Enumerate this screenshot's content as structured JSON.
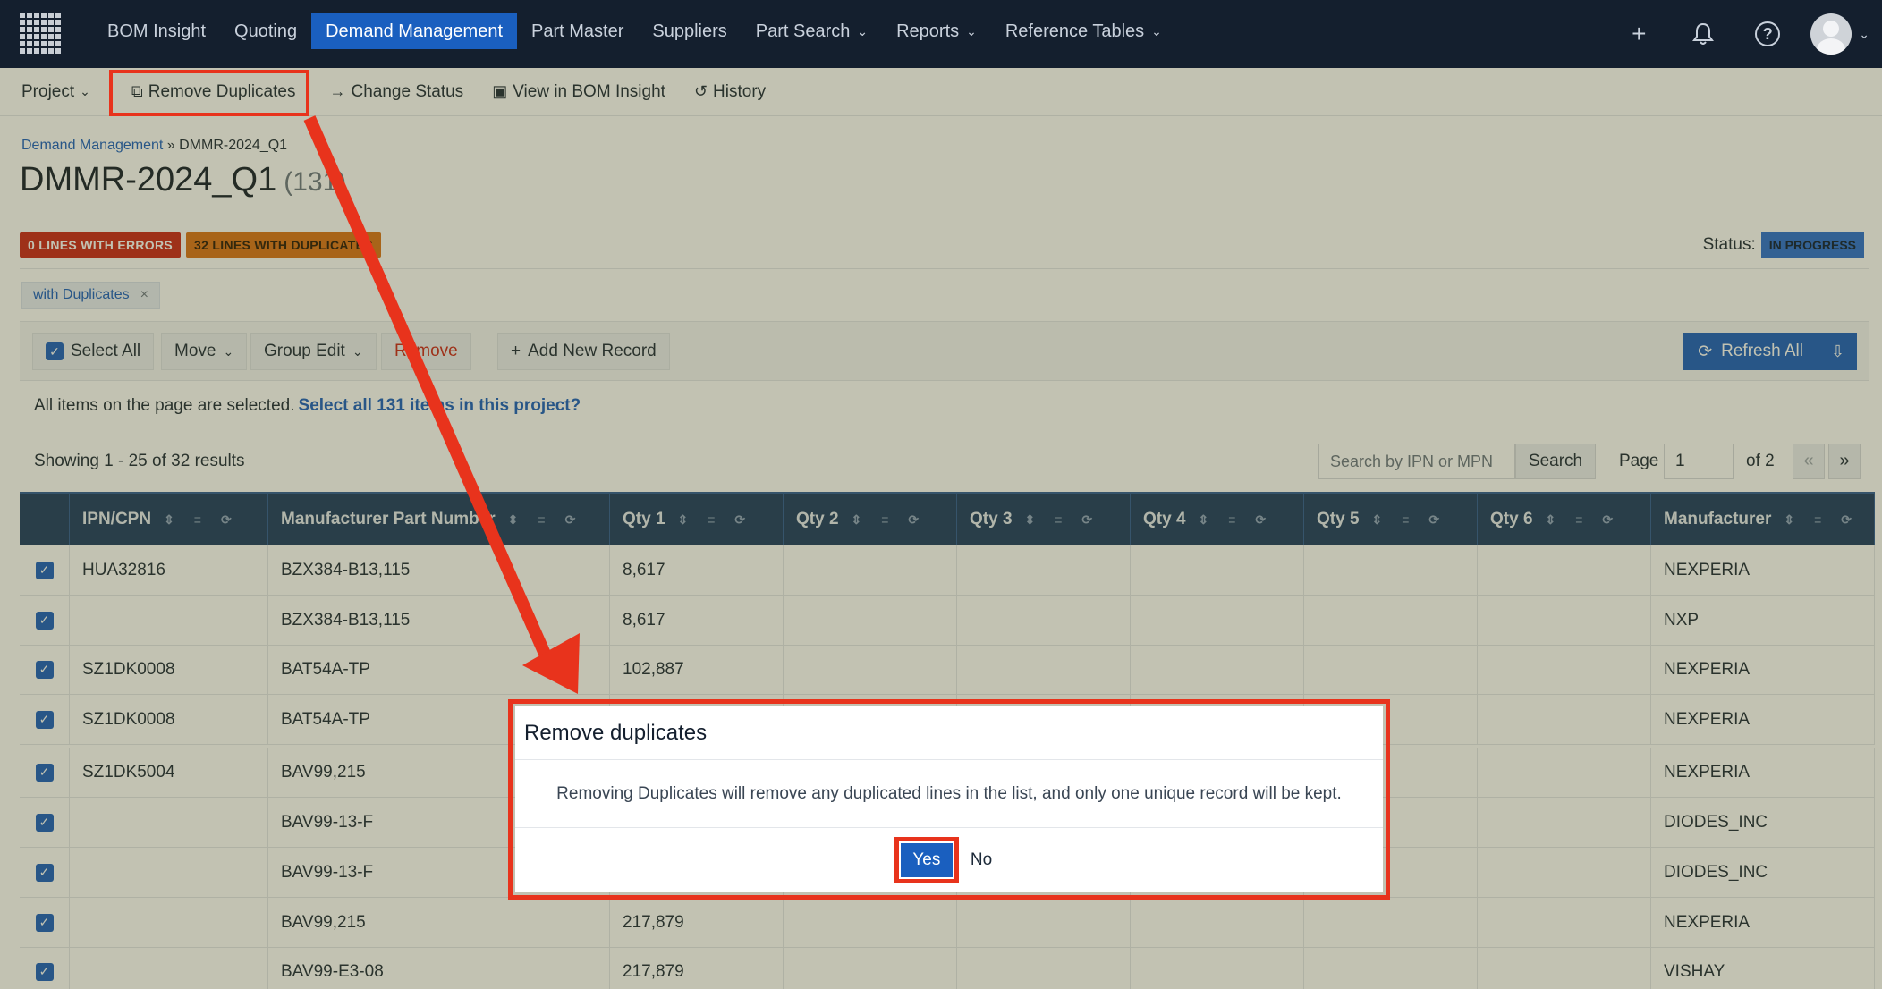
{
  "nav": {
    "items": [
      "BOM Insight",
      "Quoting",
      "Demand Management",
      "Part Master",
      "Suppliers",
      "Part Search",
      "Reports",
      "Reference Tables"
    ],
    "active": "Demand Management"
  },
  "subbar": {
    "project": "Project",
    "remove_duplicates": "Remove Duplicates",
    "change_status": "Change Status",
    "view_bom": "View in BOM Insight",
    "history": "History"
  },
  "breadcrumb": {
    "root": "Demand Management",
    "sep": "»",
    "current": "DMMR-2024_Q1"
  },
  "title": {
    "name": "DMMR-2024_Q1",
    "count": "(131)"
  },
  "badges": {
    "errors": "0 LINES WITH ERRORS",
    "duplicates": "32 LINES WITH DUPLICATES"
  },
  "status": {
    "label": "Status:",
    "value": "IN PROGRESS"
  },
  "filter_chip": "with Duplicates",
  "actions": {
    "select_all": "Select All",
    "move": "Move",
    "group_edit": "Group Edit",
    "remove": "Remove",
    "add_new": "Add New Record",
    "refresh_all": "Refresh All"
  },
  "selection": {
    "text": "All items on the page are selected.",
    "link": "Select all 131 items in this project?"
  },
  "paging": {
    "showing": "Showing 1 - 25 of 32 results",
    "search_placeholder": "Search by IPN or MPN",
    "search_btn": "Search",
    "page_label": "Page",
    "page_value": "1",
    "of_label": "of 2",
    "prev": "«",
    "next": "»"
  },
  "table": {
    "columns": [
      "IPN/CPN",
      "Manufacturer Part Number",
      "Qty 1",
      "Qty 2",
      "Qty 3",
      "Qty 4",
      "Qty 5",
      "Qty 6",
      "Manufacturer"
    ],
    "rows": [
      {
        "ipn": "HUA32816",
        "mpn": "BZX384-B13,115",
        "qty1": "8,617",
        "mfr": "NEXPERIA"
      },
      {
        "ipn": "",
        "mpn": "BZX384-B13,115",
        "qty1": "8,617",
        "mfr": "NXP"
      },
      {
        "ipn": "SZ1DK0008",
        "mpn": "BAT54A-TP",
        "qty1": "102,887",
        "mfr": "NEXPERIA"
      },
      {
        "ipn": "SZ1DK0008",
        "mpn": "BAT54A-TP",
        "qty1": "",
        "mfr": "NEXPERIA"
      },
      {
        "ipn": "SZ1DK5004",
        "mpn": "BAV99,215",
        "qty1": "",
        "mfr": "NEXPERIA"
      },
      {
        "ipn": "",
        "mpn": "BAV99-13-F",
        "qty1": "",
        "mfr": "DIODES_INC"
      },
      {
        "ipn": "",
        "mpn": "BAV99-13-F",
        "qty1": "",
        "mfr": "DIODES_INC"
      },
      {
        "ipn": "",
        "mpn": "BAV99,215",
        "qty1": "217,879",
        "mfr": "NEXPERIA"
      },
      {
        "ipn": "",
        "mpn": "BAV99-E3-08",
        "qty1": "217,879",
        "mfr": "VISHAY"
      }
    ]
  },
  "modal": {
    "title": "Remove duplicates",
    "body": "Removing Duplicates will remove any duplicated lines in the list, and only one unique record will be kept.",
    "yes": "Yes",
    "no": "No"
  },
  "colors": {
    "nav_bg": "#141f2e",
    "accent": "#1a5fbf",
    "highlight": "#e8331c",
    "error_badge": "#c9271b",
    "dup_badge": "#d9731c"
  },
  "icons": [
    "app-grid-icon",
    "plus-icon",
    "bell-icon",
    "help-icon",
    "avatar",
    "copy-icon",
    "arrow-right-icon",
    "bom-icon",
    "history-icon",
    "refresh-icon",
    "export-icon",
    "sort-icon",
    "filter-icon",
    "reset-icon"
  ]
}
